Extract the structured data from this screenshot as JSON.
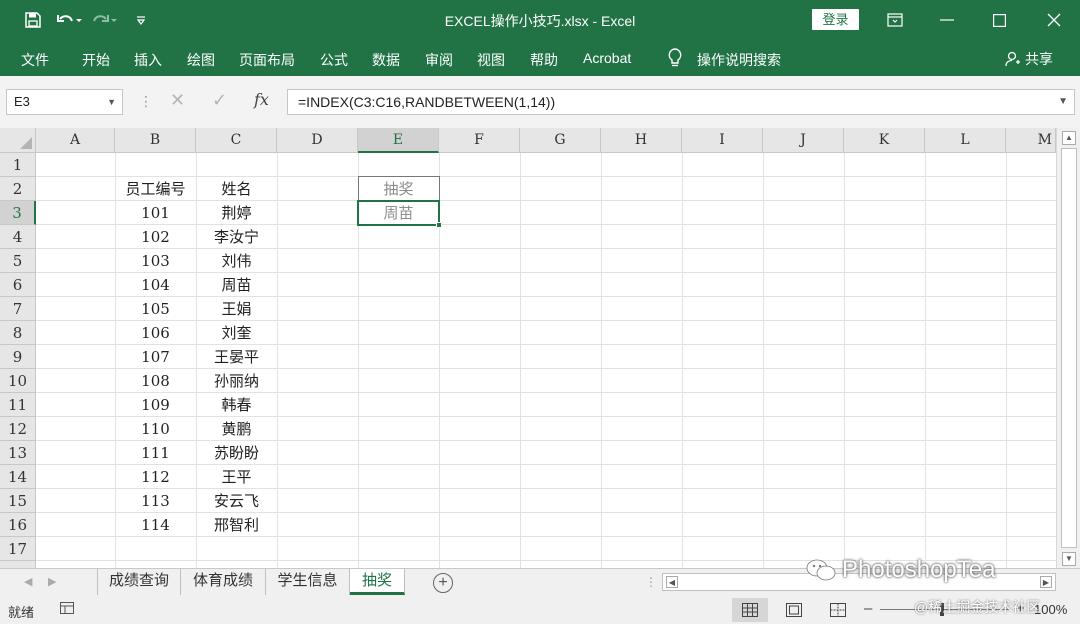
{
  "window": {
    "title": "EXCEL操作小技巧.xlsx  -  Excel",
    "login_label": "登录"
  },
  "ribbon": {
    "tabs": [
      "文件",
      "开始",
      "插入",
      "绘图",
      "页面布局",
      "公式",
      "数据",
      "审阅",
      "视图",
      "帮助",
      "Acrobat"
    ],
    "tell_me": "操作说明搜索",
    "share": "共享"
  },
  "formula_bar": {
    "name_box": "E3",
    "formula": "=INDEX(C3:C16,RANDBETWEEN(1,14))",
    "fx_label": "fx"
  },
  "grid": {
    "columns": [
      "A",
      "B",
      "C",
      "D",
      "E",
      "F",
      "G",
      "H",
      "I",
      "J",
      "K",
      "L",
      "M"
    ],
    "selected_column": "E",
    "rows": [
      "1",
      "2",
      "3",
      "4",
      "5",
      "6",
      "7",
      "8",
      "9",
      "10",
      "11",
      "12",
      "13",
      "14",
      "15",
      "16",
      "17"
    ],
    "selected_row": "3",
    "header": {
      "id": "员工编号",
      "name": "姓名"
    },
    "employees": [
      {
        "id": "101",
        "name": "荆婷"
      },
      {
        "id": "102",
        "name": "李汝宁"
      },
      {
        "id": "103",
        "name": "刘伟"
      },
      {
        "id": "104",
        "name": "周苗"
      },
      {
        "id": "105",
        "name": "王娟"
      },
      {
        "id": "106",
        "name": "刘奎"
      },
      {
        "id": "107",
        "name": "王晏平"
      },
      {
        "id": "108",
        "name": "孙丽纳"
      },
      {
        "id": "109",
        "name": "韩春"
      },
      {
        "id": "110",
        "name": "黄鹏"
      },
      {
        "id": "111",
        "name": "苏盼盼"
      },
      {
        "id": "112",
        "name": "王平"
      },
      {
        "id": "113",
        "name": "安云飞"
      },
      {
        "id": "114",
        "name": "邢智利"
      }
    ],
    "lottery_label": "抽奖",
    "lottery_result": "周苗"
  },
  "sheets": {
    "tabs": [
      "成绩查询",
      "体育成绩",
      "学生信息",
      "抽奖"
    ],
    "active": "抽奖"
  },
  "status": {
    "ready": "就绪",
    "zoom": "100%"
  },
  "watermark": {
    "brand": "PhotoshopTea",
    "community": "@稀土掘金技术社区"
  }
}
